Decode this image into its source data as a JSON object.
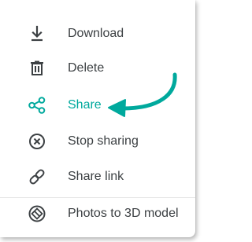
{
  "menu": {
    "items": [
      {
        "id": "download",
        "label": "Download",
        "icon": "download-icon"
      },
      {
        "id": "delete",
        "label": "Delete",
        "icon": "trash-icon"
      },
      {
        "id": "share",
        "label": "Share",
        "icon": "share-icon",
        "highlighted": true
      },
      {
        "id": "stop-sharing",
        "label": "Stop sharing",
        "icon": "cancel-circle-icon"
      },
      {
        "id": "share-link",
        "label": "Share link",
        "icon": "link-icon"
      },
      {
        "id": "photos-to-3d",
        "label": "Photos to 3D model",
        "icon": "cube-circle-icon"
      }
    ]
  },
  "colors": {
    "accent": "#00a99d",
    "icon": "#3c4043",
    "text": "#3c4043",
    "divider": "#e6e6e6"
  },
  "annotation": {
    "type": "arrow",
    "points_to": "share",
    "color": "#00a99d"
  }
}
